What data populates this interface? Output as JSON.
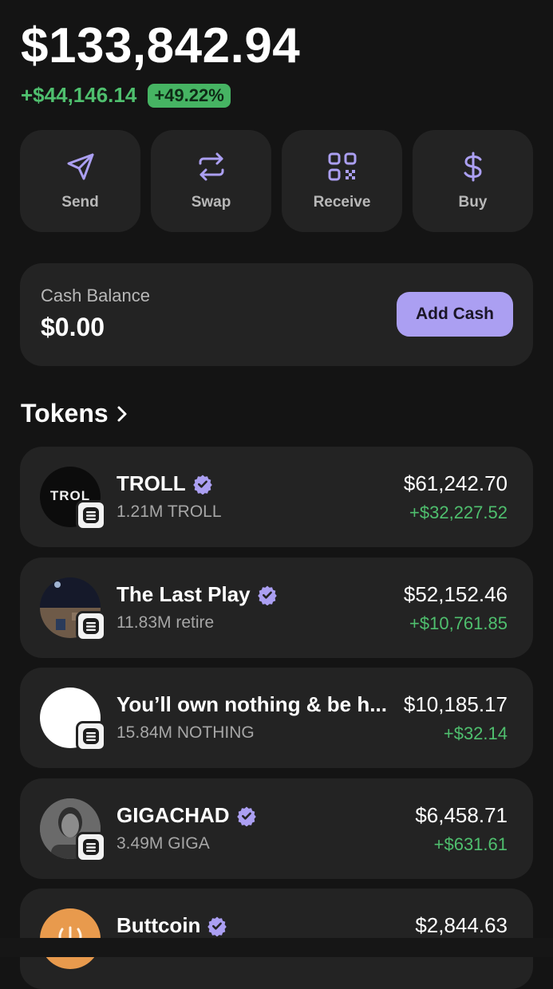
{
  "portfolio": {
    "total_balance": "$133,842.94",
    "change_amount": "+$44,146.14",
    "change_percent": "+49.22%"
  },
  "actions": [
    {
      "label": "Send",
      "icon": "send-icon"
    },
    {
      "label": "Swap",
      "icon": "swap-icon"
    },
    {
      "label": "Receive",
      "icon": "qr-code-icon"
    },
    {
      "label": "Buy",
      "icon": "dollar-icon"
    }
  ],
  "cash": {
    "title": "Cash Balance",
    "value": "$0.00",
    "button_label": "Add Cash"
  },
  "tokens_section": {
    "title": "Tokens",
    "items": [
      {
        "name": "TROLL",
        "amount": "1.21M TROLL",
        "value": "$61,242.70",
        "change": "+$32,227.52",
        "verified": true,
        "avatar_text": "TROL"
      },
      {
        "name": "The Last Play",
        "amount": "11.83M retire",
        "value": "$52,152.46",
        "change": "+$10,761.85",
        "verified": true
      },
      {
        "name": "You’ll own nothing & be h...",
        "amount": "15.84M NOTHING",
        "value": "$10,185.17",
        "change": "+$32.14",
        "verified": false
      },
      {
        "name": "GIGACHAD",
        "amount": "3.49M GIGA",
        "value": "$6,458.71",
        "change": "+$631.61",
        "verified": true
      },
      {
        "name": "Buttcoin",
        "amount": "",
        "value": "$2,844.63",
        "change": "",
        "verified": true
      }
    ]
  },
  "colors": {
    "background": "#141414",
    "card": "#232323",
    "accent": "#ab9ff2",
    "positive": "#4fbf6e"
  }
}
